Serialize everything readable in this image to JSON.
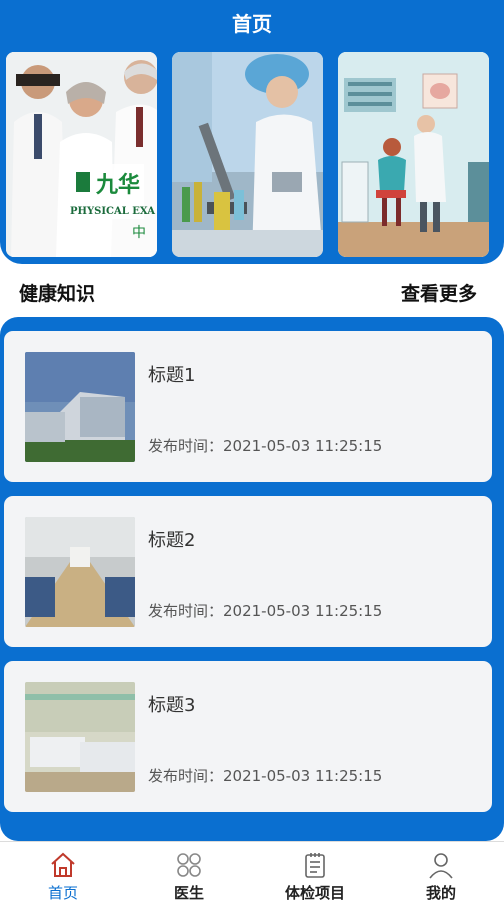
{
  "header": {
    "title": "首页"
  },
  "banner": {
    "items": [
      {
        "name": "doctors-photo",
        "caption": "九华",
        "subcaption": "PHYSICAL EXA"
      },
      {
        "name": "lab-photo"
      },
      {
        "name": "clinic-illustration"
      }
    ]
  },
  "section": {
    "title": "健康知识",
    "more": "查看更多"
  },
  "news": [
    {
      "title": "标题1",
      "time": "发布时间：2021-05-03 11:25:15"
    },
    {
      "title": "标题2",
      "time": "发布时间：2021-05-03 11:25:15"
    },
    {
      "title": "标题3",
      "time": "发布时间：2021-05-03 11:25:15"
    }
  ],
  "tabbar": {
    "items": [
      {
        "label": "首页",
        "icon": "home-icon",
        "active": true
      },
      {
        "label": "医生",
        "icon": "grid-icon",
        "active": false
      },
      {
        "label": "体检项目",
        "icon": "clipboard-icon",
        "active": false
      },
      {
        "label": "我的",
        "icon": "user-icon",
        "active": false
      }
    ]
  },
  "colors": {
    "primary": "#0a6fd0",
    "card": "#f3f4f6"
  }
}
